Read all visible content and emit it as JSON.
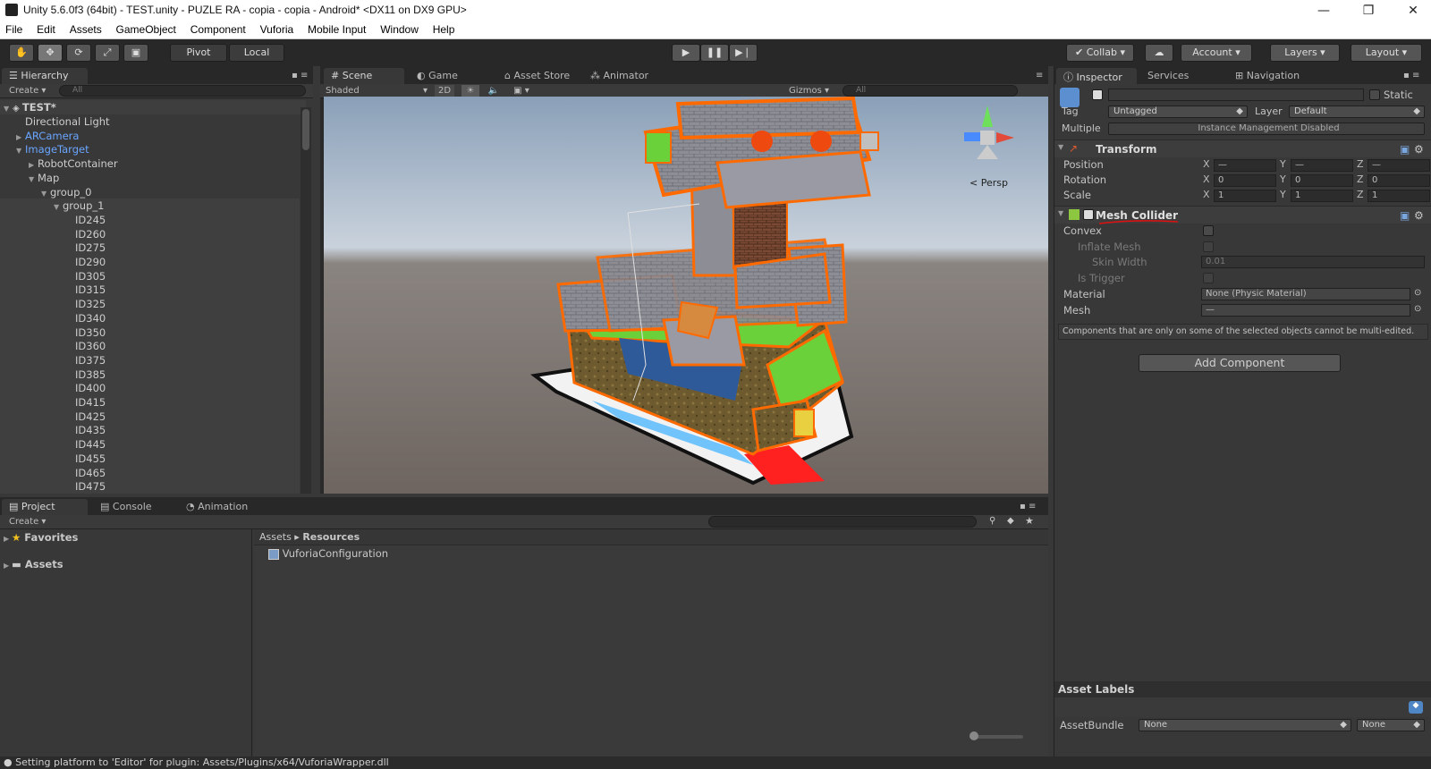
{
  "window": {
    "title": "Unity 5.6.0f3 (64bit) - TEST.unity - PUZLE RA - copia - copia - Android* <DX11 on DX9 GPU>",
    "minimize": "—",
    "restore": "❐",
    "close": "✕"
  },
  "menu": [
    "File",
    "Edit",
    "Assets",
    "GameObject",
    "Component",
    "Vuforia",
    "Mobile Input",
    "Window",
    "Help"
  ],
  "toolbar": {
    "pivot": "Pivot",
    "local": "Local",
    "collab": "Collab ▾",
    "account": "Account ▾",
    "layers": "Layers",
    "layout": "Layout"
  },
  "hierarchy": {
    "tab": "Hierarchy",
    "create": "Create ▾",
    "search_placeholder": "All",
    "scene": "TEST*",
    "items": [
      {
        "label": "Directional Light",
        "indent": 0,
        "arrow": "",
        "blue": false
      },
      {
        "label": "ARCamera",
        "indent": 0,
        "arrow": "▶",
        "blue": true
      },
      {
        "label": "ImageTarget",
        "indent": 0,
        "arrow": "▼",
        "blue": true
      },
      {
        "label": "RobotContainer",
        "indent": 1,
        "arrow": "▶",
        "blue": false
      },
      {
        "label": "Map",
        "indent": 1,
        "arrow": "▼",
        "blue": false
      },
      {
        "label": "group_0",
        "indent": 2,
        "arrow": "▼",
        "blue": false
      },
      {
        "label": "group_1",
        "indent": 3,
        "arrow": "▼",
        "blue": false
      },
      {
        "label": "ID245",
        "indent": 4,
        "arrow": "",
        "blue": false
      },
      {
        "label": "ID260",
        "indent": 4,
        "arrow": "",
        "blue": false
      },
      {
        "label": "ID275",
        "indent": 4,
        "arrow": "",
        "blue": false
      },
      {
        "label": "ID290",
        "indent": 4,
        "arrow": "",
        "blue": false
      },
      {
        "label": "ID305",
        "indent": 4,
        "arrow": "",
        "blue": false
      },
      {
        "label": "ID315",
        "indent": 4,
        "arrow": "",
        "blue": false
      },
      {
        "label": "ID325",
        "indent": 4,
        "arrow": "",
        "blue": false
      },
      {
        "label": "ID340",
        "indent": 4,
        "arrow": "",
        "blue": false
      },
      {
        "label": "ID350",
        "indent": 4,
        "arrow": "",
        "blue": false
      },
      {
        "label": "ID360",
        "indent": 4,
        "arrow": "",
        "blue": false
      },
      {
        "label": "ID375",
        "indent": 4,
        "arrow": "",
        "blue": false
      },
      {
        "label": "ID385",
        "indent": 4,
        "arrow": "",
        "blue": false
      },
      {
        "label": "ID400",
        "indent": 4,
        "arrow": "",
        "blue": false
      },
      {
        "label": "ID415",
        "indent": 4,
        "arrow": "",
        "blue": false
      },
      {
        "label": "ID425",
        "indent": 4,
        "arrow": "",
        "blue": false
      },
      {
        "label": "ID435",
        "indent": 4,
        "arrow": "",
        "blue": false
      },
      {
        "label": "ID445",
        "indent": 4,
        "arrow": "",
        "blue": false
      },
      {
        "label": "ID455",
        "indent": 4,
        "arrow": "",
        "blue": false
      },
      {
        "label": "ID465",
        "indent": 4,
        "arrow": "",
        "blue": false
      },
      {
        "label": "ID475",
        "indent": 4,
        "arrow": "",
        "blue": false
      }
    ]
  },
  "scene": {
    "tabs": [
      "Scene",
      "Game",
      "Asset Store",
      "Animator"
    ],
    "shading": "Shaded",
    "mode_2d": "2D",
    "gizmos": "Gizmos ▾",
    "search_placeholder": "All",
    "persp": "Persp",
    "gizmo_axes": {
      "y": "y",
      "x": "x",
      "z": "z"
    }
  },
  "inspector": {
    "tabs": [
      "Inspector",
      "Services",
      "Navigation"
    ],
    "static_label": "Static",
    "tag_label": "Tag",
    "tag_value": "Untagged",
    "layer_label": "Layer",
    "layer_value": "Default",
    "multiple_label": "Multiple",
    "multiple_value": "Instance Management Disabled",
    "transform": {
      "title": "Transform",
      "position_label": "Position",
      "rotation_label": "Rotation",
      "scale_label": "Scale",
      "position": [
        "—",
        "—",
        "—"
      ],
      "rotation": [
        "0",
        "0",
        "0"
      ],
      "scale": [
        "1",
        "1",
        "1"
      ]
    },
    "mesh_collider": {
      "title": "Mesh Collider",
      "convex": "Convex",
      "inflate_mesh": "Inflate Mesh",
      "skin_width": "Skin Width",
      "skin_width_value": "0.01",
      "is_trigger": "Is Trigger",
      "material": "Material",
      "material_value": "None (Physic Material)",
      "mesh": "Mesh",
      "mesh_value": "—"
    },
    "multi_edit_note": "Components that are only on some of the selected objects cannot be multi-edited.",
    "add_component": "Add Component",
    "asset_labels": "Asset Labels",
    "assetbundle_label": "AssetBundle",
    "assetbundle_value": "None",
    "assetbundle_variant": "None"
  },
  "project": {
    "tabs": [
      "Project",
      "Console",
      "Animation"
    ],
    "create": "Create ▾",
    "favorites": "Favorites",
    "assets": "Assets",
    "breadcrumb_root": "Assets",
    "breadcrumb_current": "Resources",
    "files": [
      "VuforiaConfiguration"
    ]
  },
  "status": "Setting platform to 'Editor' for plugin: Assets/Plugins/x64/VuforiaWrapper.dll",
  "colors": {
    "selection_orange": "#ff6a00",
    "editor_bg": "#383838",
    "link_blue": "#6aa6ff"
  }
}
